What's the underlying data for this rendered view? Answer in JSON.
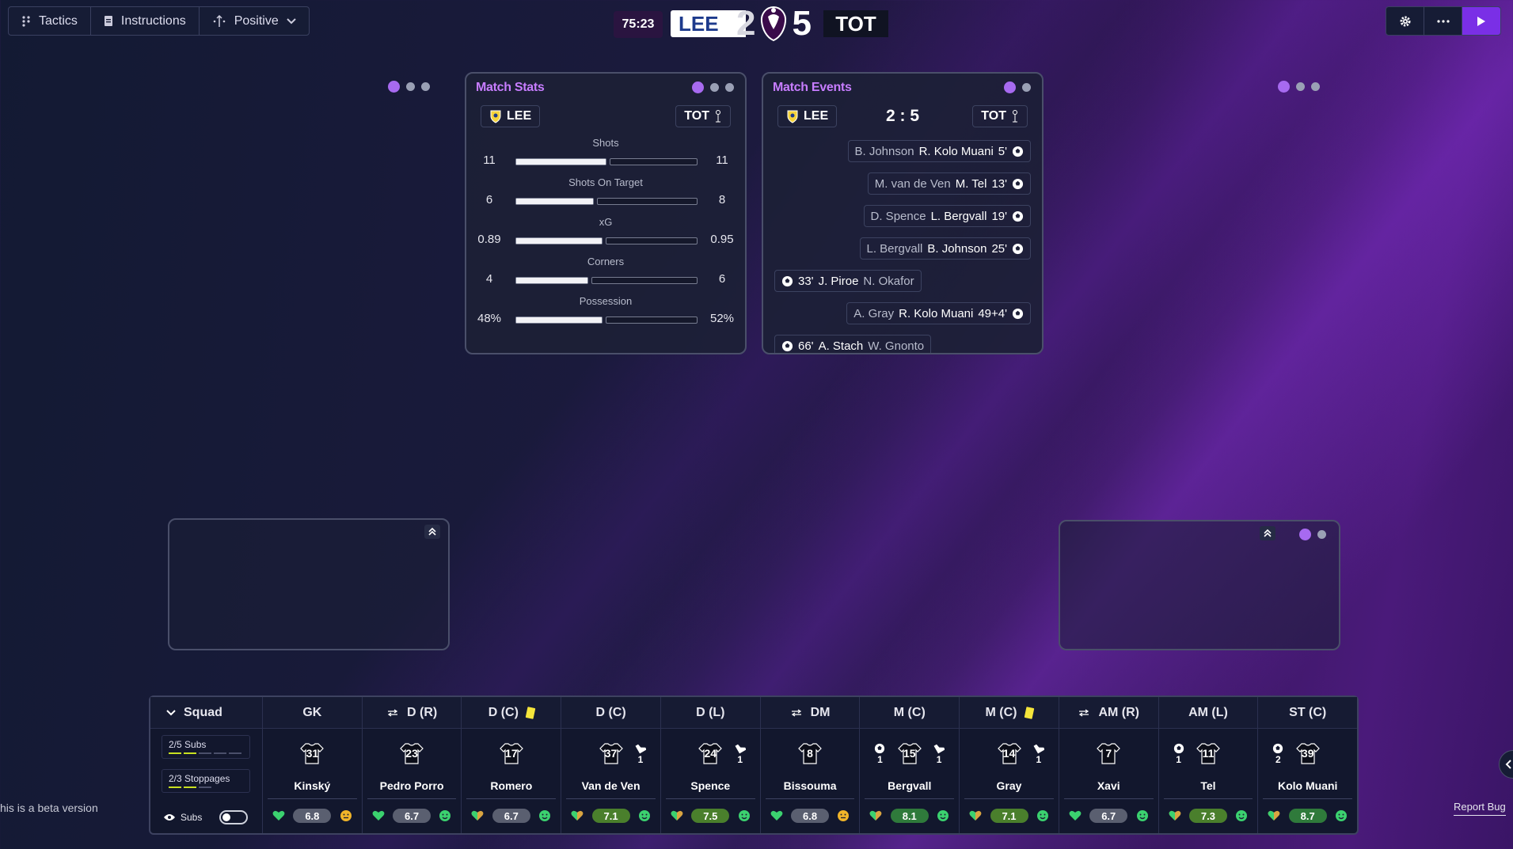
{
  "toolbar": {
    "tactics": "Tactics",
    "instructions": "Instructions",
    "mentality": "Positive"
  },
  "scoreboard": {
    "clock": "75:23",
    "home": "LEE",
    "home_score": "2",
    "away_score": "5",
    "away": "TOT"
  },
  "stats_panel": {
    "title": "Match Stats",
    "home": "LEE",
    "away": "TOT",
    "rows": [
      {
        "label": "Shots",
        "home": "11",
        "away": "11",
        "home_share": 0.5
      },
      {
        "label": "Shots On Target",
        "home": "6",
        "away": "8",
        "home_share": 0.43
      },
      {
        "label": "xG",
        "home": "0.89",
        "away": "0.95",
        "home_share": 0.48
      },
      {
        "label": "Corners",
        "home": "4",
        "away": "6",
        "home_share": 0.4
      },
      {
        "label": "Possession",
        "home": "48%",
        "away": "52%",
        "home_share": 0.48
      }
    ]
  },
  "events_panel": {
    "title": "Match Events",
    "home": "LEE",
    "away": "TOT",
    "score": "2 : 5",
    "events": [
      {
        "assist": "B. Johnson",
        "scorer": "R. Kolo Muani",
        "minute": "5'",
        "side": "away"
      },
      {
        "assist": "M. van de Ven",
        "scorer": "M. Tel",
        "minute": "13'",
        "side": "away"
      },
      {
        "assist": "D. Spence",
        "scorer": "L. Bergvall",
        "minute": "19'",
        "side": "away"
      },
      {
        "assist": "L. Bergvall",
        "scorer": "B. Johnson",
        "minute": "25'",
        "side": "away"
      },
      {
        "assist": "N. Okafor",
        "scorer": "J. Piroe",
        "minute": "33'",
        "side": "home"
      },
      {
        "assist": "A. Gray",
        "scorer": "R. Kolo Muani",
        "minute": "49+4'",
        "side": "away"
      },
      {
        "assist": "W. Gnonto",
        "scorer": "A. Stach",
        "minute": "66'",
        "side": "home"
      }
    ]
  },
  "squad": {
    "title": "Squad",
    "subs": "2/5 Subs",
    "stoppages": "2/3 Stoppages",
    "subs_toggle": "Subs",
    "players": [
      {
        "pos": "GK",
        "number": "31",
        "name": "Kinský",
        "rating": "6.8",
        "swap": false,
        "card": false,
        "goals": "",
        "assists": "",
        "rating_style": "n"
      },
      {
        "pos": "D (R)",
        "number": "23",
        "name": "Pedro Porro",
        "rating": "6.7",
        "swap": true,
        "card": false,
        "goals": "",
        "assists": "",
        "rating_style": "n"
      },
      {
        "pos": "D (C)",
        "number": "17",
        "name": "Romero",
        "rating": "6.7",
        "swap": false,
        "card": true,
        "goals": "",
        "assists": "",
        "rating_style": "n"
      },
      {
        "pos": "D (C)",
        "number": "37",
        "name": "Van de Ven",
        "rating": "7.1",
        "swap": false,
        "card": false,
        "goals": "",
        "assists": "1",
        "rating_style": "gb"
      },
      {
        "pos": "D (L)",
        "number": "24",
        "name": "Spence",
        "rating": "7.5",
        "swap": false,
        "card": false,
        "goals": "",
        "assists": "1",
        "rating_style": "gb"
      },
      {
        "pos": "DM",
        "number": "8",
        "name": "Bissouma",
        "rating": "6.8",
        "swap": true,
        "card": false,
        "goals": "",
        "assists": "",
        "rating_style": "n"
      },
      {
        "pos": "M (C)",
        "number": "15",
        "name": "Bergvall",
        "rating": "8.1",
        "swap": false,
        "card": false,
        "goals": "1",
        "assists": "1",
        "rating_style": "g"
      },
      {
        "pos": "M (C)",
        "number": "14",
        "name": "Gray",
        "rating": "7.1",
        "swap": false,
        "card": true,
        "goals": "",
        "assists": "1",
        "rating_style": "gb"
      },
      {
        "pos": "AM (R)",
        "number": "7",
        "name": "Xavi",
        "rating": "6.7",
        "swap": true,
        "card": false,
        "goals": "",
        "assists": "",
        "rating_style": "n"
      },
      {
        "pos": "AM (L)",
        "number": "11",
        "name": "Tel",
        "rating": "7.3",
        "swap": false,
        "card": false,
        "goals": "1",
        "assists": "",
        "rating_style": "gb"
      },
      {
        "pos": "ST (C)",
        "number": "39",
        "name": "Kolo Muani",
        "rating": "8.7",
        "swap": false,
        "card": false,
        "goals": "2",
        "assists": "",
        "rating_style": "g"
      }
    ]
  },
  "footer": {
    "beta": "his is a beta version",
    "report": "Report Bug"
  },
  "colors": {
    "accent": "#7a2fe6",
    "title": "#c77dff",
    "card": "#f5e53b",
    "good": "#2f7a3b"
  }
}
